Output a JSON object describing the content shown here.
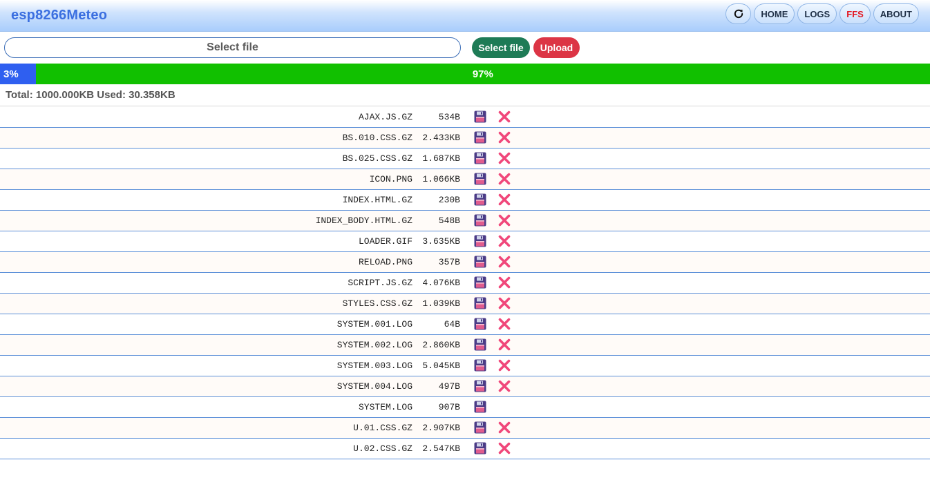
{
  "app": {
    "brand": "esp8266Meteo"
  },
  "nav": {
    "refresh_icon": "refresh-icon",
    "items": [
      {
        "label": "HOME"
      },
      {
        "label": "LOGS"
      },
      {
        "label": "FFS",
        "active": true
      },
      {
        "label": "ABOUT"
      }
    ]
  },
  "upload": {
    "file_input_text": "Select file",
    "select_button": "Select file",
    "upload_button": "Upload"
  },
  "storage": {
    "used_percent_label": "3%",
    "free_percent_label": "97%",
    "used_fraction": 0.03,
    "summary": "Total: 1000.000KB Used: 30.358KB"
  },
  "colors": {
    "brand": "#3b6fe0",
    "used_bar": "#2f5ff0",
    "free_bar": "#11c000",
    "select_button": "#1e7b56",
    "upload_button": "#dc3545",
    "active_nav": "#e3141e"
  },
  "icons": {
    "save": "floppy-disk-icon",
    "delete": "delete-x-icon"
  },
  "files": [
    {
      "name": "AJAX.JS.GZ",
      "size": "534B",
      "deletable": true
    },
    {
      "name": "BS.010.CSS.GZ",
      "size": "2.433KB",
      "deletable": true
    },
    {
      "name": "BS.025.CSS.GZ",
      "size": "1.687KB",
      "deletable": true
    },
    {
      "name": "ICON.PNG",
      "size": "1.066KB",
      "deletable": true
    },
    {
      "name": "INDEX.HTML.GZ",
      "size": "230B",
      "deletable": true
    },
    {
      "name": "INDEX_BODY.HTML.GZ",
      "size": "548B",
      "deletable": true
    },
    {
      "name": "LOADER.GIF",
      "size": "3.635KB",
      "deletable": true
    },
    {
      "name": "RELOAD.PNG",
      "size": "357B",
      "deletable": true
    },
    {
      "name": "SCRIPT.JS.GZ",
      "size": "4.076KB",
      "deletable": true
    },
    {
      "name": "STYLES.CSS.GZ",
      "size": "1.039KB",
      "deletable": true
    },
    {
      "name": "SYSTEM.001.LOG",
      "size": "64B",
      "deletable": true
    },
    {
      "name": "SYSTEM.002.LOG",
      "size": "2.860KB",
      "deletable": true
    },
    {
      "name": "SYSTEM.003.LOG",
      "size": "5.045KB",
      "deletable": true
    },
    {
      "name": "SYSTEM.004.LOG",
      "size": "497B",
      "deletable": true
    },
    {
      "name": "SYSTEM.LOG",
      "size": "907B",
      "deletable": false
    },
    {
      "name": "U.01.CSS.GZ",
      "size": "2.907KB",
      "deletable": true
    },
    {
      "name": "U.02.CSS.GZ",
      "size": "2.547KB",
      "deletable": true
    }
  ]
}
